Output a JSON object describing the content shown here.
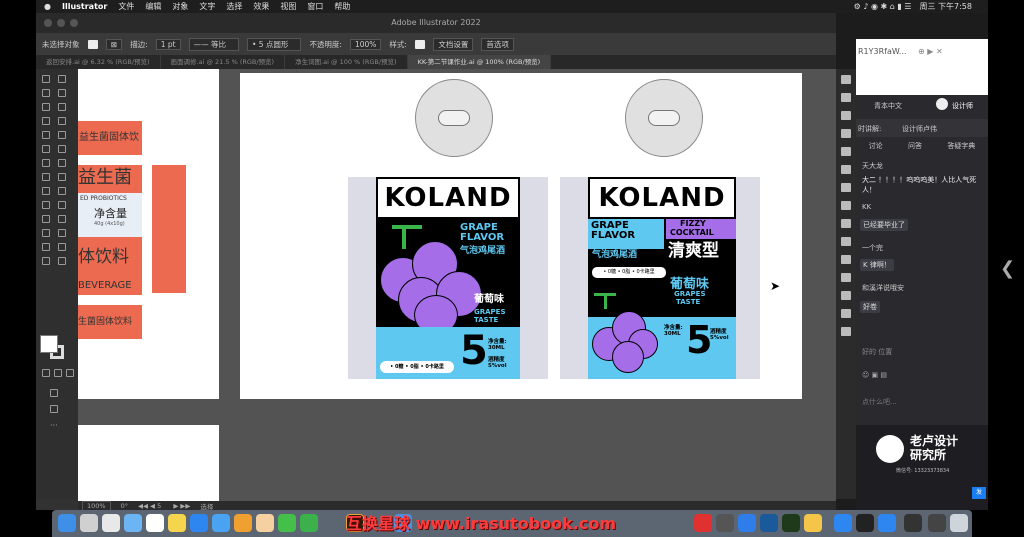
{
  "menubar": {
    "app": "Illustrator",
    "items": [
      "文件",
      "编辑",
      "对象",
      "文字",
      "选择",
      "效果",
      "视图",
      "窗口",
      "帮助"
    ],
    "clock": "周三 下午7:58"
  },
  "window": {
    "title": "Adobe Illustrator 2022"
  },
  "control": {
    "selection": "未选择对象",
    "stroke_label": "描边:",
    "stroke_value": "1 pt",
    "line_style": "等比",
    "brush": "5 点圆形",
    "opacity_label": "不透明度:",
    "opacity_value": "100%",
    "style_label": "样式:",
    "doc_setup": "文档设置",
    "prefs": "首选项"
  },
  "tabs": [
    {
      "label": "返回安排.ai @ 6.32 % (RGB/预览)"
    },
    {
      "label": "画面调修.ai @ 21.5 % (RGB/预览)"
    },
    {
      "label": "净生词图.ai @ 100 % (RGB/预览)"
    },
    {
      "label": "KK-第二节课作业.ai @ 100% (RGB/预览)"
    }
  ],
  "status": {
    "zoom": "100%",
    "angle": "0°",
    "page": "5",
    "mode": "选择"
  },
  "labels": {
    "solid_beverage": "益生菌固体饮料",
    "probiotic": "益生菌",
    "probiotics_en": "ED PROBIOTICS",
    "net_content": "净含量",
    "net_detail": "40g (4x10g)",
    "drink": "体饮料",
    "beverage": "BEVERAGE",
    "solid_beverage2": "生菌固体饮料"
  },
  "can1": {
    "brand": "KOLAND",
    "flavor1": "GRAPE",
    "flavor2": "FLAVOR",
    "cn_name": "气泡鸡尾酒",
    "taste_cn": "葡萄味",
    "taste_en1": "GRAPES",
    "taste_en2": "TASTE",
    "net": "净含量:",
    "volume": "30ML",
    "num": "5",
    "abv_label": "酒精度",
    "abv": "5%vol",
    "tags": "• 0糖 • 0脂 • 0卡路里"
  },
  "can2": {
    "brand": "KOLAND",
    "flavor1": "GRAPE",
    "flavor2": "FLAVOR",
    "fizzy1": "FIZZY",
    "fizzy2": "COCKTAIL",
    "cn_name": "气泡鸡尾酒",
    "refresh": "清爽型",
    "tags": "• 0糖 • 0脂 • 0卡路里",
    "taste_cn": "葡萄味",
    "taste_en1": "GRAPES",
    "taste_en2": "TASTE",
    "net": "净含量:",
    "volume": "30ML",
    "num": "5",
    "abv_label": "酒精度",
    "abv": "5%vol"
  },
  "browser": {
    "url": "R1Y3RfaW..."
  },
  "chat": {
    "header": "青本中文",
    "host": "设计师",
    "live": "时讲解:",
    "host2": "设计师卢伟",
    "tabs": [
      "讨论",
      "问答",
      "答疑字典"
    ],
    "messages": [
      {
        "name": "天大龙",
        "text": ""
      },
      {
        "name": "",
        "text": "大二 ！！！！呜呜呜美！人比人气死人！"
      },
      {
        "name": "KK",
        "text": ""
      },
      {
        "name": "",
        "text": "已经要毕业了"
      },
      {
        "name": "一个完",
        "text": ""
      },
      {
        "name": "",
        "text": "K 律啊！"
      },
      {
        "name": "和溪洋说哦安",
        "text": ""
      },
      {
        "name": "",
        "text": "好卷"
      }
    ],
    "position": "好的 位置",
    "input_hint": "点什么吧...",
    "logo1": "老卢设计",
    "logo2": "研究所",
    "wechat": "微信号: 13323373834",
    "send": "发"
  },
  "watermark": "互换星球 www.irasutobook.com"
}
